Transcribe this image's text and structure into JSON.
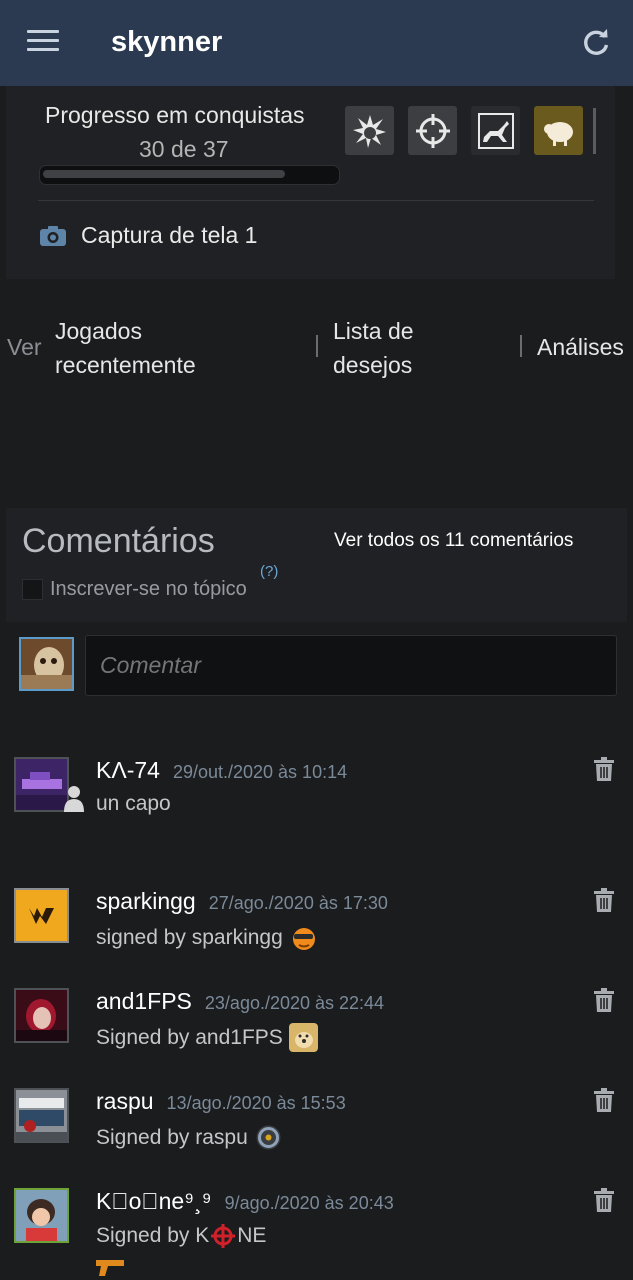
{
  "header": {
    "title": "skynner",
    "menu_icon": "menu-icon",
    "refresh_icon": "refresh-icon"
  },
  "achievements": {
    "title": "Progresso em conquistas",
    "count": "30 de 37",
    "progress_fraction": 0.81,
    "badges": [
      "skull-splash-badge",
      "crosshair-badge",
      "deer-badge",
      "sheep-badge"
    ]
  },
  "screenshots": {
    "label": "Captura de tela 1",
    "icon": "camera-icon"
  },
  "nav": {
    "ver": "Ver",
    "recent_line1": "Jogados",
    "recent_line2": "recentemente",
    "wishlist_line1": "Lista de",
    "wishlist_line2": "desejos",
    "reviews": "Análises"
  },
  "comments": {
    "title": "Comentários",
    "view_all": "Ver todos os 11 comentários",
    "subscribe": "Inscrever-se no tópico",
    "help": "(?)",
    "input_placeholder": "Comentar",
    "items": [
      {
        "author": "KΛ-74",
        "date": "29/out./2020 às 10:14",
        "text": "un capo"
      },
      {
        "author": "sparkingg",
        "date": "27/ago./2020 às 17:30",
        "text": "signed by sparkingg"
      },
      {
        "author": "and1FPS",
        "date": "23/ago./2020 às 22:44",
        "text": "Signed by and1FPS"
      },
      {
        "author": "raspu",
        "date": "13/ago./2020 às 15:53",
        "text": "Signed by raspu"
      },
      {
        "author": "Kᷧoᷢne⁹¸⁹",
        "date": "9/ago./2020 às 20:43",
        "text": "Signed by K",
        "text_suffix": "NE"
      }
    ]
  },
  "colors": {
    "header_bg": "#2b3a50",
    "panel_bg": "#202124",
    "page_bg": "#1b1c1e",
    "date": "#7b8a99",
    "link_blue": "#69a7d6"
  }
}
